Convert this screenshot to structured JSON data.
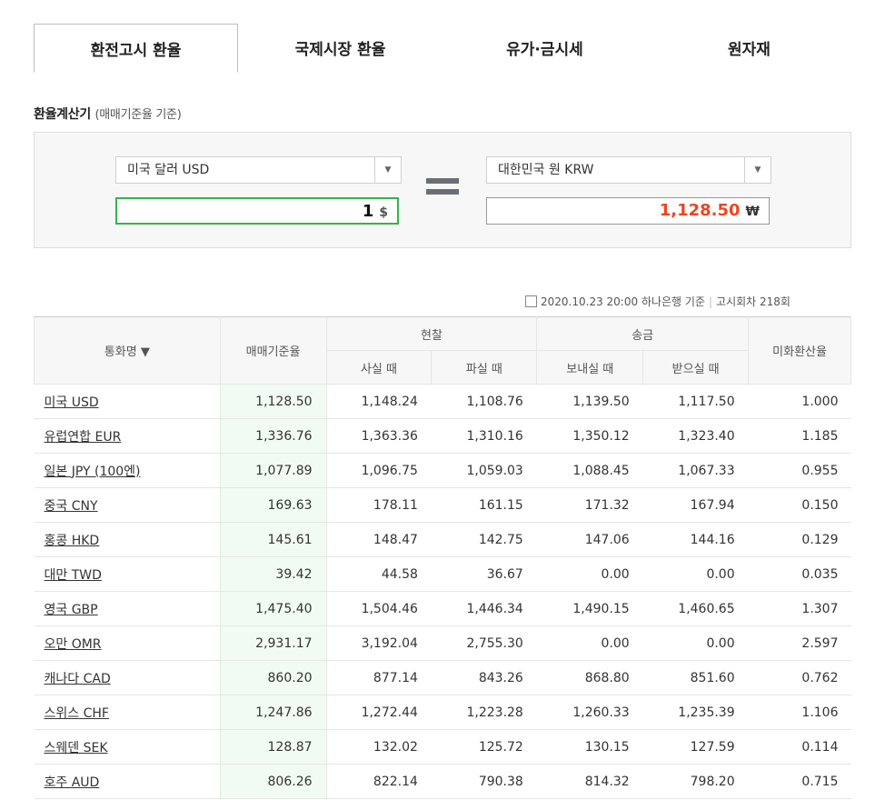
{
  "tabs": [
    {
      "label": "환전고시 환율",
      "active": true
    },
    {
      "label": "국제시장 환율",
      "active": false
    },
    {
      "label": "유가·금시세",
      "active": false
    },
    {
      "label": "원자재",
      "active": false
    }
  ],
  "calculator": {
    "title": "환율계산기",
    "subtitle": "(매매기준율 기준)",
    "from_currency": "미국 달러 USD",
    "to_currency": "대한민국 원 KRW",
    "from_amount": "1",
    "from_unit": "$",
    "to_amount": "1,128.50",
    "to_unit": "₩"
  },
  "meta": {
    "datetime": "2020.10.23 20:00",
    "bank": "하나은행 기준",
    "round": "고시회차 218회"
  },
  "table": {
    "headers": {
      "currency": "통화명",
      "base_rate": "매매기준율",
      "cash": "현찰",
      "cash_buy": "사실 때",
      "cash_sell": "파실 때",
      "remit": "송금",
      "remit_send": "보내실 때",
      "remit_receive": "받으실 때",
      "usd_rate": "미화환산율"
    },
    "rows": [
      {
        "name": "미국 USD",
        "base": "1,128.50",
        "cash_buy": "1,148.24",
        "cash_sell": "1,108.76",
        "send": "1,139.50",
        "receive": "1,117.50",
        "usd": "1.000"
      },
      {
        "name": "유럽연합 EUR",
        "base": "1,336.76",
        "cash_buy": "1,363.36",
        "cash_sell": "1,310.16",
        "send": "1,350.12",
        "receive": "1,323.40",
        "usd": "1.185"
      },
      {
        "name": "일본 JPY (100엔)",
        "base": "1,077.89",
        "cash_buy": "1,096.75",
        "cash_sell": "1,059.03",
        "send": "1,088.45",
        "receive": "1,067.33",
        "usd": "0.955"
      },
      {
        "name": "중국 CNY",
        "base": "169.63",
        "cash_buy": "178.11",
        "cash_sell": "161.15",
        "send": "171.32",
        "receive": "167.94",
        "usd": "0.150"
      },
      {
        "name": "홍콩 HKD",
        "base": "145.61",
        "cash_buy": "148.47",
        "cash_sell": "142.75",
        "send": "147.06",
        "receive": "144.16",
        "usd": "0.129"
      },
      {
        "name": "대만 TWD",
        "base": "39.42",
        "cash_buy": "44.58",
        "cash_sell": "36.67",
        "send": "0.00",
        "receive": "0.00",
        "usd": "0.035"
      },
      {
        "name": "영국 GBP",
        "base": "1,475.40",
        "cash_buy": "1,504.46",
        "cash_sell": "1,446.34",
        "send": "1,490.15",
        "receive": "1,460.65",
        "usd": "1.307"
      },
      {
        "name": "오만 OMR",
        "base": "2,931.17",
        "cash_buy": "3,192.04",
        "cash_sell": "2,755.30",
        "send": "0.00",
        "receive": "0.00",
        "usd": "2.597"
      },
      {
        "name": "캐나다 CAD",
        "base": "860.20",
        "cash_buy": "877.14",
        "cash_sell": "843.26",
        "send": "868.80",
        "receive": "851.60",
        "usd": "0.762"
      },
      {
        "name": "스위스 CHF",
        "base": "1,247.86",
        "cash_buy": "1,272.44",
        "cash_sell": "1,223.28",
        "send": "1,260.33",
        "receive": "1,235.39",
        "usd": "1.106"
      },
      {
        "name": "스웨덴 SEK",
        "base": "128.87",
        "cash_buy": "132.02",
        "cash_sell": "125.72",
        "send": "130.15",
        "receive": "127.59",
        "usd": "0.114"
      },
      {
        "name": "호주 AUD",
        "base": "806.26",
        "cash_buy": "822.14",
        "cash_sell": "790.38",
        "send": "814.32",
        "receive": "798.20",
        "usd": "0.715"
      }
    ]
  }
}
